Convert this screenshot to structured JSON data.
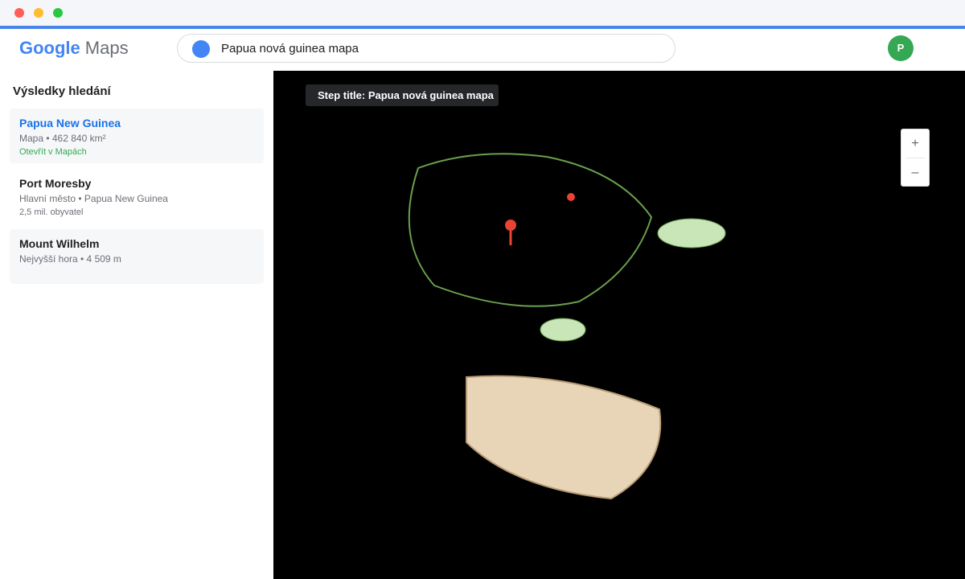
{
  "brand": {
    "google": "Google",
    "maps": "Maps"
  },
  "search": {
    "query": "Papua nová guinea mapa"
  },
  "user": {
    "avatar_initial": "P"
  },
  "sidebar": {
    "title": "Výsledky hledání",
    "results": [
      {
        "name": "Papua New Guinea",
        "meta": "Mapa • 462 840 km²",
        "extra": "Otevřít v Mapách"
      },
      {
        "name": "Port Moresby",
        "meta": "Hlavní město • Papua New Guinea",
        "extra": "2,5 mil. obyvatel"
      },
      {
        "name": "Mount Wilhelm",
        "meta": "Nejvyšší hora • 4 509 m"
      }
    ]
  },
  "map": {
    "step_title": "Step title: Papua nová guinea mapa",
    "zoom_in_label": "+",
    "zoom_out_label": "–"
  },
  "colors": {
    "accent": "#4a86e8",
    "brand_blue": "#4285f4",
    "avatar_green": "#34a853",
    "map_background": "#000000",
    "island_outline": "#6a9f4e",
    "island_fill": "#c9e6b8",
    "landmass_fill": "#e8d5b8",
    "marker_red": "#ea4335"
  },
  "icons": {
    "search": "search-dot-icon",
    "pin": "map-pin-icon",
    "marker": "red-dot-marker-icon"
  }
}
